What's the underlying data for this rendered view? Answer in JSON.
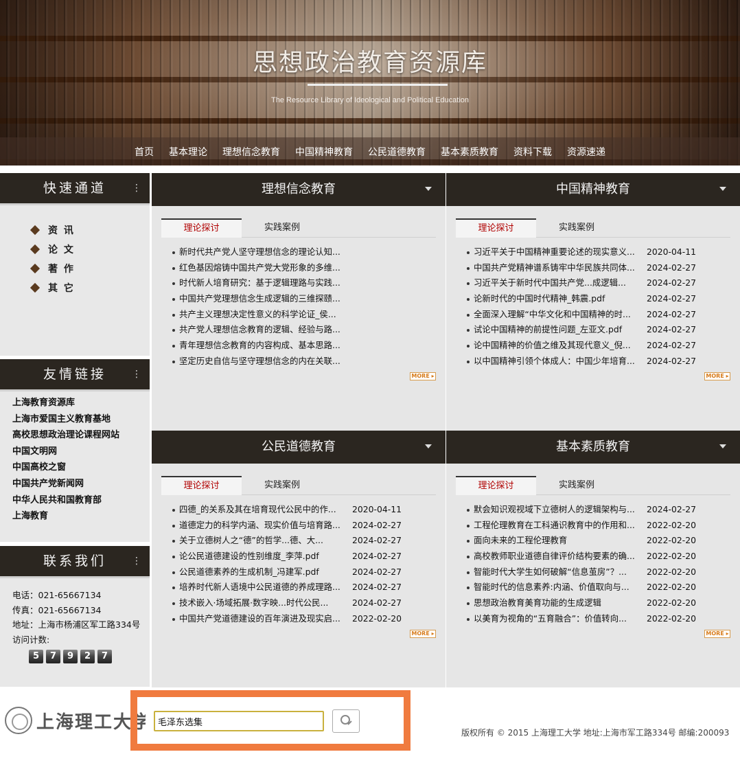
{
  "banner": {
    "title": "思想政治教育资源库",
    "subtitle": "The Resource Library of  Ideological and Political Education"
  },
  "nav": [
    "首页",
    "基本理论",
    "理想信念教育",
    "中国精神教育",
    "公民道德教育",
    "基本素质教育",
    "资料下载",
    "资源速递"
  ],
  "sidebar": {
    "quick": {
      "title": "快速通道",
      "items": [
        "资 讯",
        "论 文",
        "著 作",
        "其 它"
      ]
    },
    "links": {
      "title": "友情链接",
      "items": [
        "上海教育资源库",
        "上海市爱国主义教育基地",
        "高校思想政治理论课程网站",
        "中国文明网",
        "中国高校之窗",
        "中国共产党新闻网",
        "中华人民共和国教育部",
        "上海教育"
      ]
    },
    "contact": {
      "title": "联系我们",
      "phone": "电话：021-65667134",
      "fax": "传真：021-65667134",
      "address": "地址：上海市杨浦区军工路334号",
      "visits_label": "访问计数:",
      "visits_digits": [
        "5",
        "7",
        "9",
        "2",
        "7"
      ]
    }
  },
  "panels": [
    {
      "title": "理想信念教育",
      "tab_active": "理论探讨",
      "tab_other": "实践案例",
      "more": "MORE ▸",
      "items": [
        {
          "title": "新时代共产党人坚守理想信念的理论认知...",
          "date": ""
        },
        {
          "title": "红色基因熔铸中国共产党大党形象的多维...",
          "date": ""
        },
        {
          "title": "时代新人培育研究：基于逻辑理路与实践...",
          "date": ""
        },
        {
          "title": "中国共产党理想信念生成逻辑的三维探赜...",
          "date": ""
        },
        {
          "title": "共产主义理想决定性意义的科学论证_侯...",
          "date": ""
        },
        {
          "title": "共产党人理想信念教育的逻辑、经验与路...",
          "date": ""
        },
        {
          "title": "青年理想信念教育的内容构成、基本思路...",
          "date": ""
        },
        {
          "title": "坚定历史自信与坚守理想信念的内在关联...",
          "date": ""
        }
      ]
    },
    {
      "title": "中国精神教育",
      "tab_active": "理论探讨",
      "tab_other": "实践案例",
      "more": "MORE ▸",
      "items": [
        {
          "title": "习近平关于中国精神重要论述的现实意义...",
          "date": "2020-04-11"
        },
        {
          "title": "中国共产党精神谱系铸牢中华民族共同体...",
          "date": "2024-02-27"
        },
        {
          "title": "习近平关于新时代中国共产党...成逻辑...",
          "date": "2024-02-27"
        },
        {
          "title": "论新时代的中国时代精神_韩震.pdf",
          "date": "2024-02-27"
        },
        {
          "title": "全面深入理解“中华文化和中国精神的时...",
          "date": "2024-02-27"
        },
        {
          "title": "试论中国精神的前提性问题_左亚文.pdf",
          "date": "2024-02-27"
        },
        {
          "title": "论中国精神的价值之维及其现代意义_倪...",
          "date": "2024-02-27"
        },
        {
          "title": "以中国精神引领个体成人：中国少年培育...",
          "date": "2024-02-27"
        }
      ]
    },
    {
      "title": "公民道德教育",
      "tab_active": "理论探讨",
      "tab_other": "实践案例",
      "more": "MORE ▸",
      "items": [
        {
          "title": "四德_的关系及其在培育现代公民中的作...",
          "date": "2020-04-11"
        },
        {
          "title": "道德定力的科学内涵、现实价值与培育路...",
          "date": "2024-02-27"
        },
        {
          "title": "关于立德树人之“德”的哲学...德、大...",
          "date": "2024-02-27"
        },
        {
          "title": "论公民道德建设的性别维度_李萍.pdf",
          "date": "2024-02-27"
        },
        {
          "title": "公民道德素养的生成机制_冯建军.pdf",
          "date": "2024-02-27"
        },
        {
          "title": "培养时代新人语境中公民道德的养成理路...",
          "date": "2024-02-27"
        },
        {
          "title": "技术嵌入·场域拓展·数字映...时代公民...",
          "date": "2024-02-27"
        },
        {
          "title": "中国共产党道德建设的百年演进及现实启...",
          "date": "2022-02-20"
        }
      ]
    },
    {
      "title": "基本素质教育",
      "tab_active": "理论探讨",
      "tab_other": "实践案例",
      "more": "MORE ▸",
      "items": [
        {
          "title": "默会知识观视域下立德树人的逻辑架构与...",
          "date": "2024-02-27"
        },
        {
          "title": "工程伦理教育在工科通识教育中的作用和...",
          "date": "2022-02-20"
        },
        {
          "title": "面向未来的工程伦理教育",
          "date": "2022-02-20"
        },
        {
          "title": "高校教师职业道德自律评价结构要素的确...",
          "date": "2022-02-20"
        },
        {
          "title": "智能时代大学生如何破解“信息茧房”？...",
          "date": "2022-02-20"
        },
        {
          "title": "智能时代的信息素养:内涵、价值取向与...",
          "date": "2022-02-20"
        },
        {
          "title": "思想政治教育美育功能的生成逻辑",
          "date": "2022-02-20"
        },
        {
          "title": "以美育为视角的“五育融合”：价值转向...",
          "date": "2022-02-20"
        }
      ]
    }
  ],
  "footer": {
    "logo_text": "上海理工大学",
    "search_value": "毛泽东选集",
    "copyright": "版权所有 © 2015 上海理工大学 地址:上海市军工路334号 邮编:200093"
  }
}
